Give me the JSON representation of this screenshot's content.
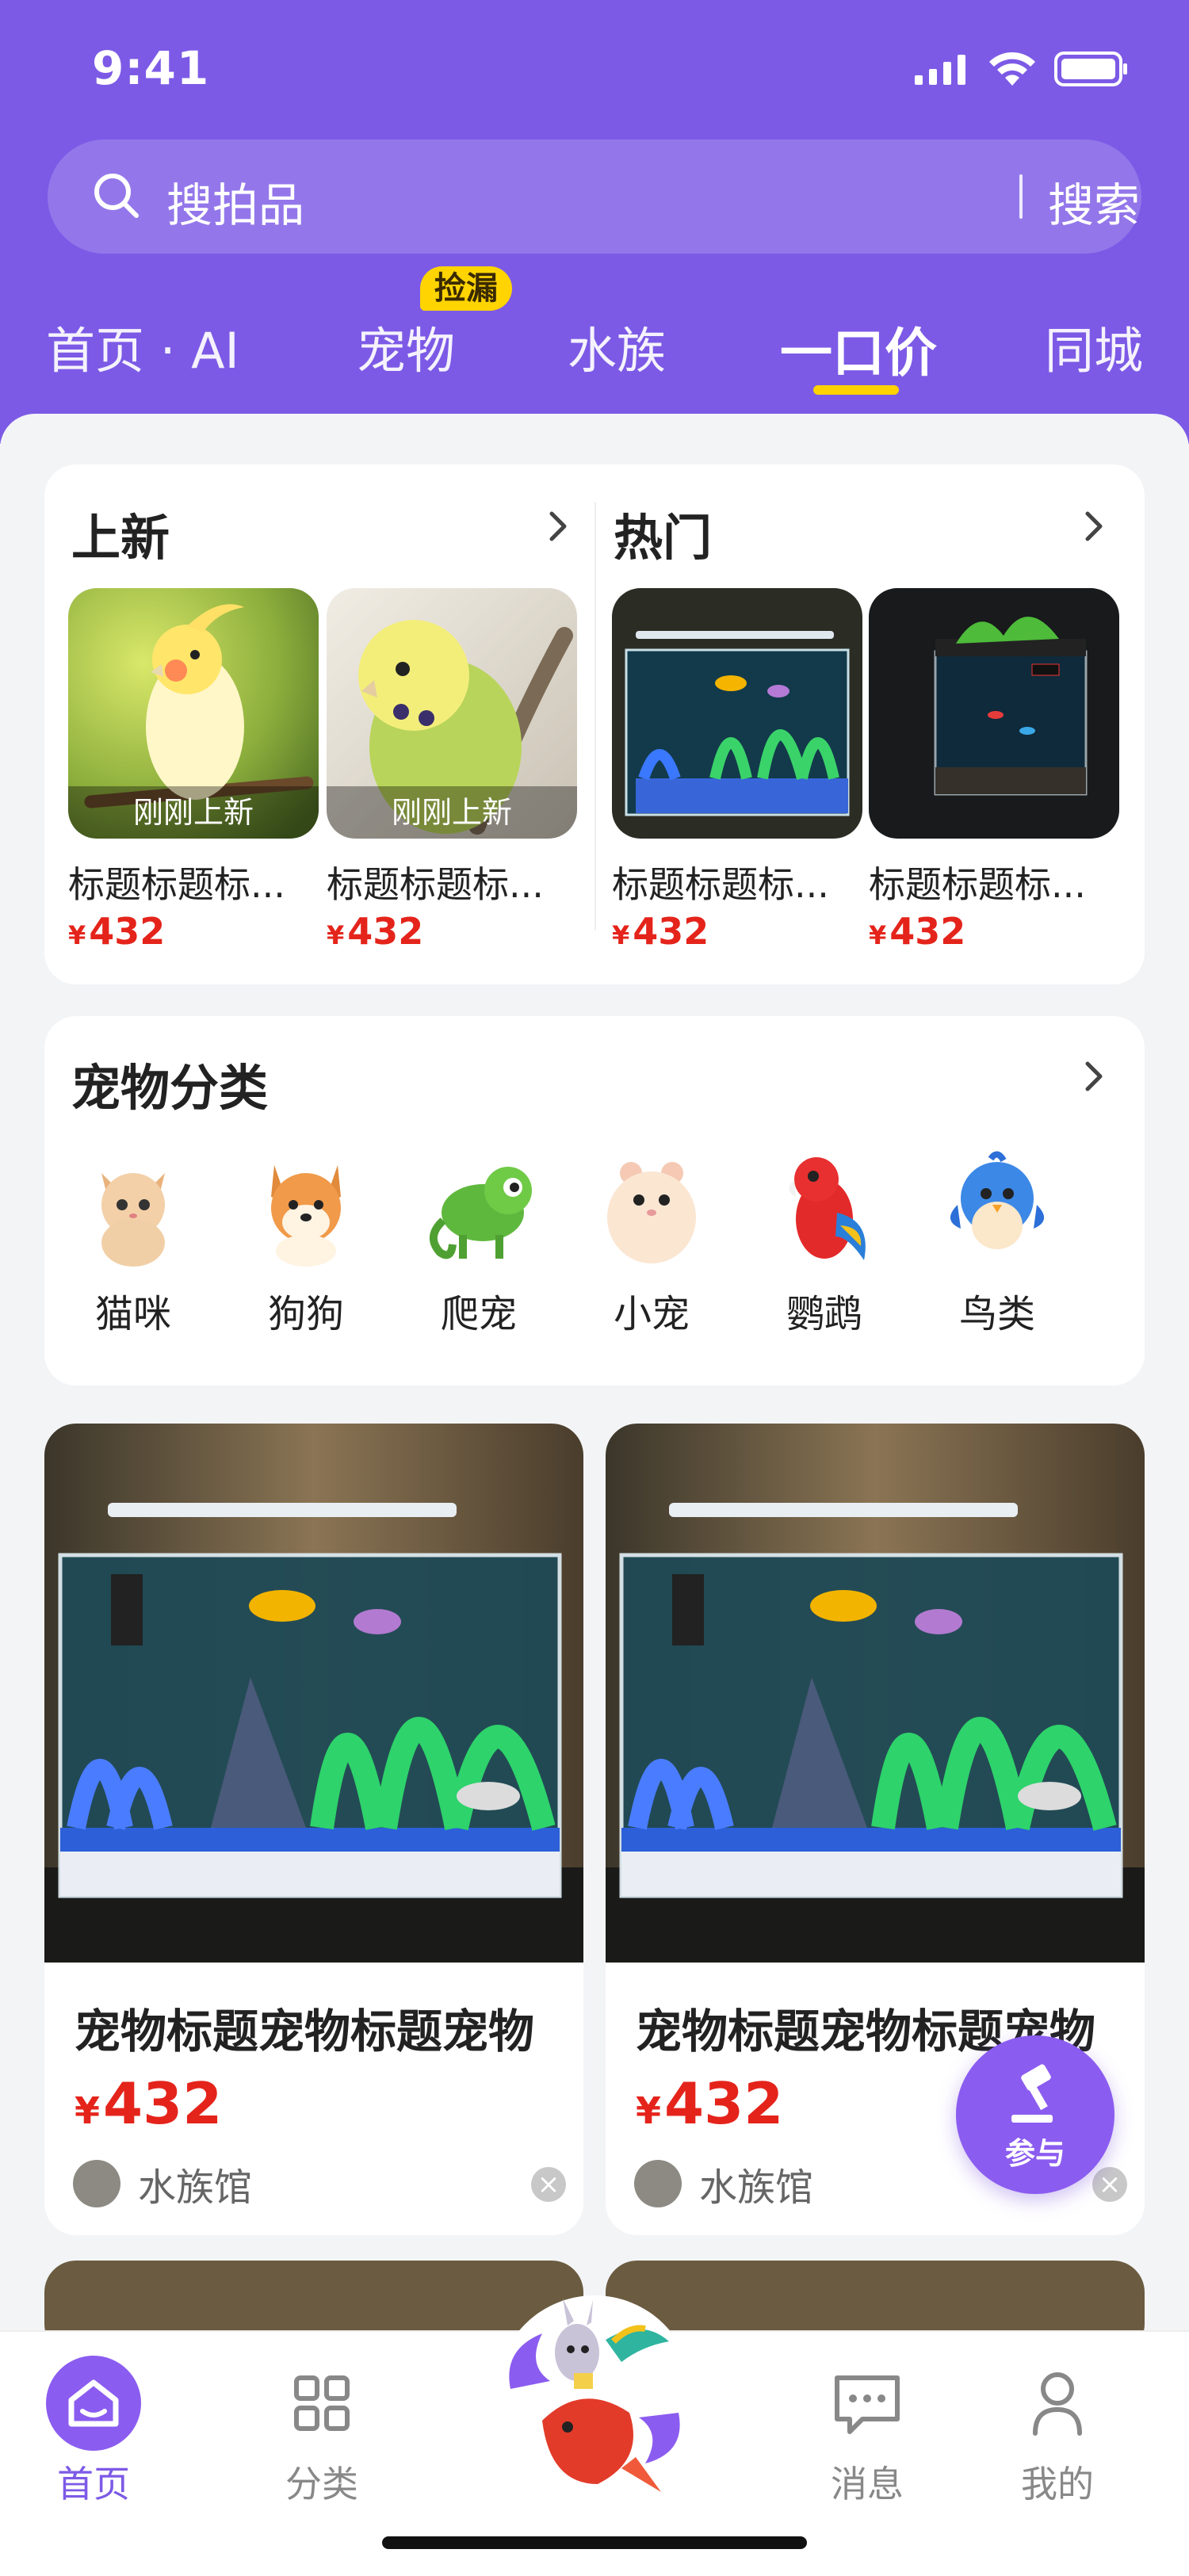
{
  "status": {
    "time": "9:41"
  },
  "search": {
    "placeholder": "搜拍品",
    "button": "搜索"
  },
  "tabs": [
    {
      "label": "首页 · AI",
      "active": false
    },
    {
      "label": "宠物",
      "active": false,
      "badge": "捡漏"
    },
    {
      "label": "水族",
      "active": false
    },
    {
      "label": "一口价",
      "active": true
    },
    {
      "label": "同城",
      "active": false
    }
  ],
  "new_panel": {
    "title": "上新",
    "items": [
      {
        "tag": "刚刚上新",
        "title": "标题标题标...",
        "price": "432"
      },
      {
        "tag": "刚刚上新",
        "title": "标题标题标...",
        "price": "432"
      }
    ]
  },
  "hot_panel": {
    "title": "热门",
    "items": [
      {
        "title": "标题标题标...",
        "price": "432"
      },
      {
        "title": "标题标题标...",
        "price": "432"
      }
    ]
  },
  "categories": {
    "title": "宠物分类",
    "items": [
      {
        "label": "猫咪",
        "icon": "cat-icon"
      },
      {
        "label": "狗狗",
        "icon": "dog-icon"
      },
      {
        "label": "爬宠",
        "icon": "chameleon-icon"
      },
      {
        "label": "小宠",
        "icon": "hamster-icon"
      },
      {
        "label": "鹦鹉",
        "icon": "parrot-icon"
      },
      {
        "label": "鸟类",
        "icon": "bird-icon"
      }
    ]
  },
  "products": [
    {
      "title": "宠物标题宠物标题宠物",
      "price": "432",
      "shop": "水族馆"
    },
    {
      "title": "宠物标题宠物标题宠物",
      "price": "432",
      "shop": "水族馆"
    }
  ],
  "currency": "¥",
  "fab": {
    "label": "参与"
  },
  "tabbar": [
    {
      "label": "首页",
      "active": true
    },
    {
      "label": "分类",
      "active": false
    },
    {
      "label": "消息",
      "active": false
    },
    {
      "label": "我的",
      "active": false
    }
  ],
  "colors": {
    "brand": "#7c5ae6",
    "price": "#e4241b",
    "badge": "#ffd400"
  }
}
